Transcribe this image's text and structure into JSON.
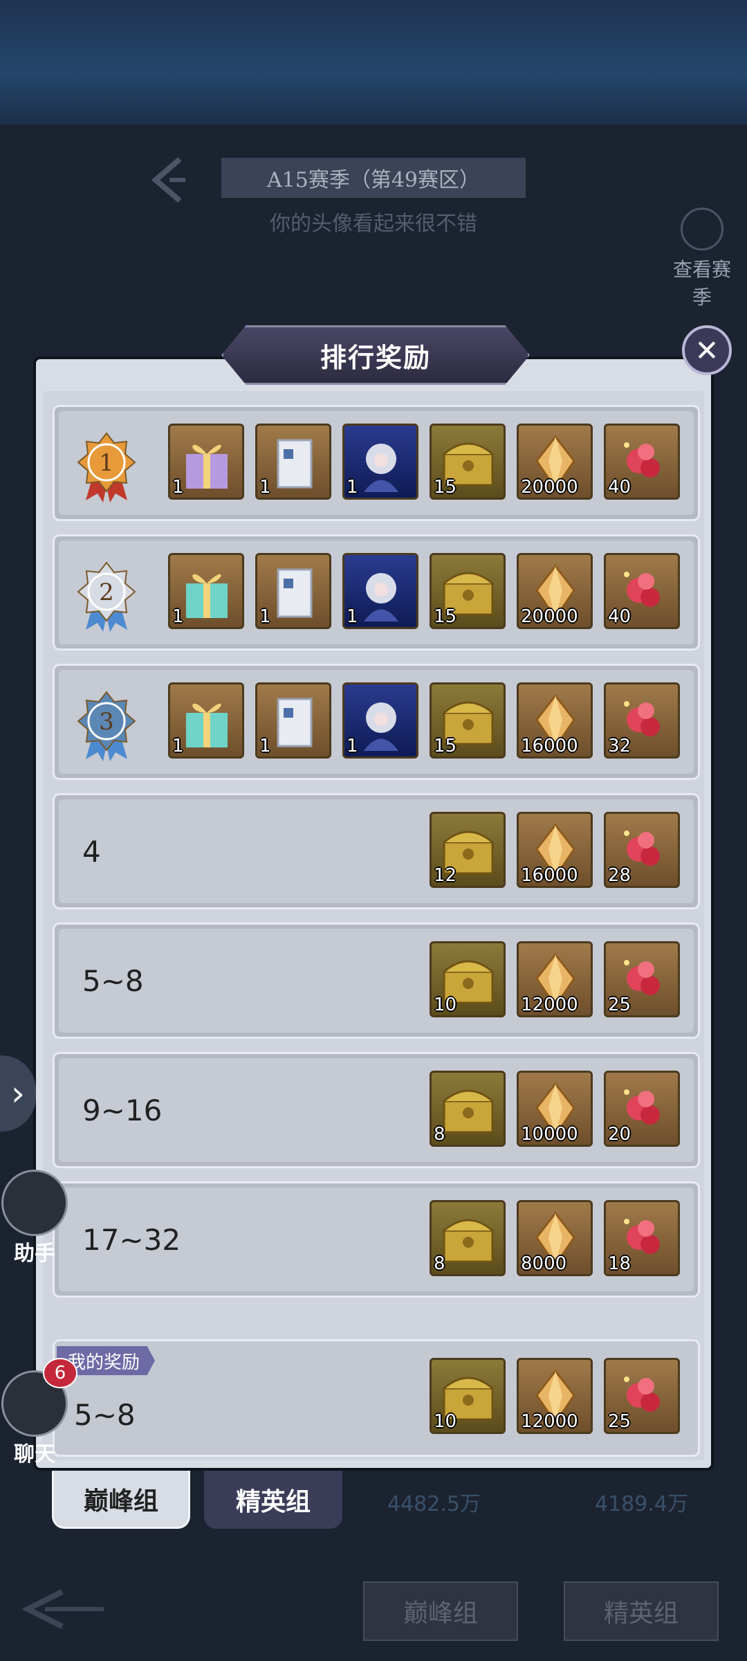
{
  "background": {
    "season_title": "A15赛季（第49赛区）",
    "season_subtitle": "你的头像看起来很不错",
    "search_label": "查看赛季",
    "behind_values": [
      "4482.5万",
      "4189.4万"
    ]
  },
  "dialog": {
    "title": "排行奖励",
    "rows": [
      {
        "rank": "1",
        "medal": "gold",
        "items": [
          {
            "icon": "gift-box-purple-icon",
            "qty": "1"
          },
          {
            "icon": "scroll-card-icon",
            "qty": "1"
          },
          {
            "icon": "hero-portrait-icon",
            "qty": "1"
          },
          {
            "icon": "treasure-chest-icon",
            "qty": "15"
          },
          {
            "icon": "crystal-icon",
            "qty": "20000"
          },
          {
            "icon": "red-gem-icon",
            "qty": "40"
          }
        ]
      },
      {
        "rank": "2",
        "medal": "silver",
        "items": [
          {
            "icon": "gift-box-teal-icon",
            "qty": "1"
          },
          {
            "icon": "scroll-card-icon",
            "qty": "1"
          },
          {
            "icon": "hero-portrait-icon",
            "qty": "1"
          },
          {
            "icon": "treasure-chest-icon",
            "qty": "15"
          },
          {
            "icon": "crystal-icon",
            "qty": "20000"
          },
          {
            "icon": "red-gem-icon",
            "qty": "40"
          }
        ]
      },
      {
        "rank": "3",
        "medal": "blue",
        "items": [
          {
            "icon": "gift-box-teal-icon",
            "qty": "1"
          },
          {
            "icon": "scroll-card-icon",
            "qty": "1"
          },
          {
            "icon": "hero-portrait-icon",
            "qty": "1"
          },
          {
            "icon": "treasure-chest-icon",
            "qty": "15"
          },
          {
            "icon": "crystal-icon",
            "qty": "16000"
          },
          {
            "icon": "red-gem-icon",
            "qty": "32"
          }
        ]
      },
      {
        "rank": "4",
        "items": [
          {
            "icon": "treasure-chest-icon",
            "qty": "12"
          },
          {
            "icon": "crystal-icon",
            "qty": "16000"
          },
          {
            "icon": "red-gem-icon",
            "qty": "28"
          }
        ]
      },
      {
        "rank": "5~8",
        "items": [
          {
            "icon": "treasure-chest-icon",
            "qty": "10"
          },
          {
            "icon": "crystal-icon",
            "qty": "12000"
          },
          {
            "icon": "red-gem-icon",
            "qty": "25"
          }
        ]
      },
      {
        "rank": "9~16",
        "items": [
          {
            "icon": "treasure-chest-icon",
            "qty": "8"
          },
          {
            "icon": "crystal-icon",
            "qty": "10000"
          },
          {
            "icon": "red-gem-icon",
            "qty": "20"
          }
        ]
      },
      {
        "rank": "17~32",
        "items": [
          {
            "icon": "treasure-chest-icon",
            "qty": "8"
          },
          {
            "icon": "crystal-icon",
            "qty": "8000"
          },
          {
            "icon": "red-gem-icon",
            "qty": "18"
          }
        ]
      }
    ],
    "my_reward": {
      "label": "我的奖励",
      "rank": "5~8",
      "items": [
        {
          "icon": "treasure-chest-icon",
          "qty": "10"
        },
        {
          "icon": "crystal-icon",
          "qty": "12000"
        },
        {
          "icon": "red-gem-icon",
          "qty": "25"
        }
      ]
    },
    "tabs": {
      "active": "巅峰组",
      "inactive": "精英组"
    }
  },
  "sidebar": {
    "assistant_label": "助手",
    "chat_label": "聊天",
    "chat_badge": "6"
  },
  "bottom": {
    "btn_peak": "巅峰组",
    "btn_elite": "精英组"
  },
  "colors": {
    "panel": "#d7dce5",
    "row": "#c6cad3",
    "title_banner": "#3b3a55",
    "item_frame": "#6e4f2c"
  }
}
